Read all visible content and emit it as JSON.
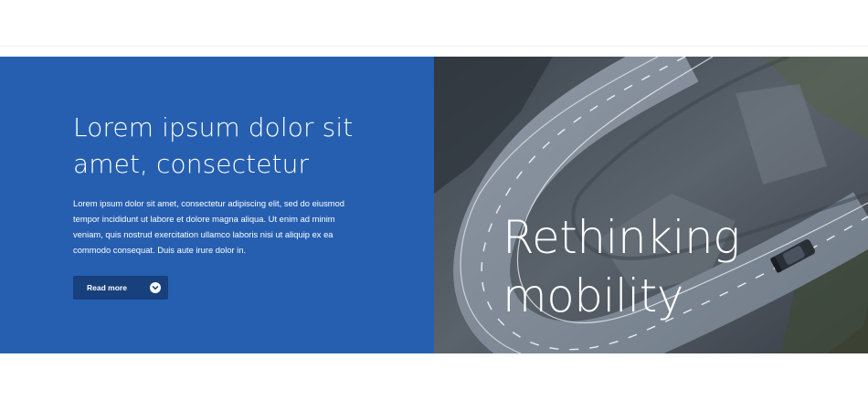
{
  "hero": {
    "headline_line1": "Lorem ipsum dolor sit",
    "headline_line2": "amet, consectetur",
    "body_line1": "Lorem ipsum dolor sit amet, consectetur adipiscing elit, sed do eiusmod",
    "body_line2": "tempor incididunt ut labore et dolore magna aliqua. Ut enim ad minim",
    "body_line3": "veniam, quis nostrud exercitation ullamco laboris nisi ut aliquip ex ea",
    "body_line4": "commodo consequat. Duis aute irure dolor in.",
    "cta_label": "Read more",
    "cta_icon": "chevron-down-icon",
    "panel_color": "#265fb0",
    "cta_color": "#17407d"
  },
  "image": {
    "overlay_line1": "Rethinking",
    "overlay_line2": "mobility"
  }
}
